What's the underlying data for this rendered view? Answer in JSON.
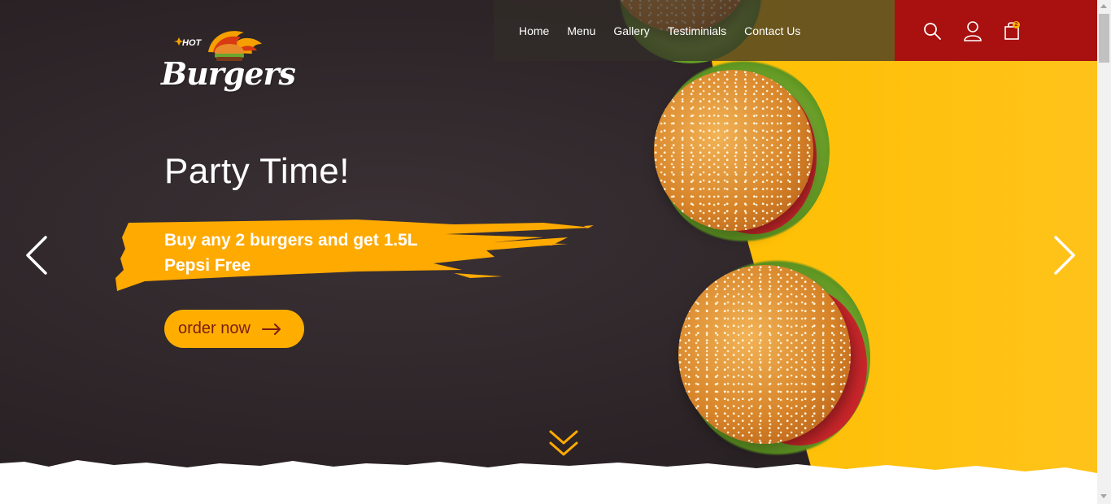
{
  "nav": {
    "links": [
      "Home",
      "Menu",
      "Gallery",
      "Testiminials",
      "Contact Us"
    ]
  },
  "icons": {
    "search": "search-icon",
    "user": "user-icon",
    "cart": "shopping-bag-icon",
    "cart_count": "2"
  },
  "logo": {
    "hot": "HOT",
    "brand": "Burgers"
  },
  "hero": {
    "headline": "Party Time!",
    "promo": "Buy any 2 burgers and get 1.5L Pepsi Free",
    "cta_label": "order now",
    "prev_icon": "chevron-left-icon",
    "next_icon": "chevron-right-icon",
    "scroll_icon": "double-chevron-down-icon"
  },
  "colors": {
    "dark_bg": "#2e2628",
    "yellow": "#ffbf00",
    "accent_orange": "#ffae00",
    "icon_bar_red": "#a8110f",
    "cta_text": "#7a1d12"
  }
}
